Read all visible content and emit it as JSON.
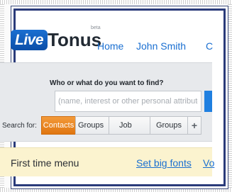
{
  "header": {
    "logo_live": "Live",
    "logo_tonus": "Tonus",
    "logo_beta": "beta",
    "nav": [
      {
        "label": "Home"
      },
      {
        "label": "John Smith"
      },
      {
        "label": "C"
      }
    ]
  },
  "search": {
    "question": "Who or what do you want to find?",
    "placeholder": "(name, interest or other personal attributes)",
    "value": "",
    "search_for_label": "Search for:",
    "segments": [
      {
        "label": "Contacts",
        "selected": true
      },
      {
        "label": "Groups"
      },
      {
        "label": "Job"
      },
      {
        "label": "Groups"
      },
      {
        "label": "+"
      }
    ]
  },
  "first_time_menu": {
    "title": "First time menu",
    "links": [
      {
        "label": "Set big fonts"
      },
      {
        "label": "Vo"
      }
    ]
  },
  "colors": {
    "brand_blue": "#1a6fd1",
    "selected_orange": "#e07610",
    "panel_gray": "#e7e9ec",
    "ftm_yellow": "#fbf3cf"
  }
}
